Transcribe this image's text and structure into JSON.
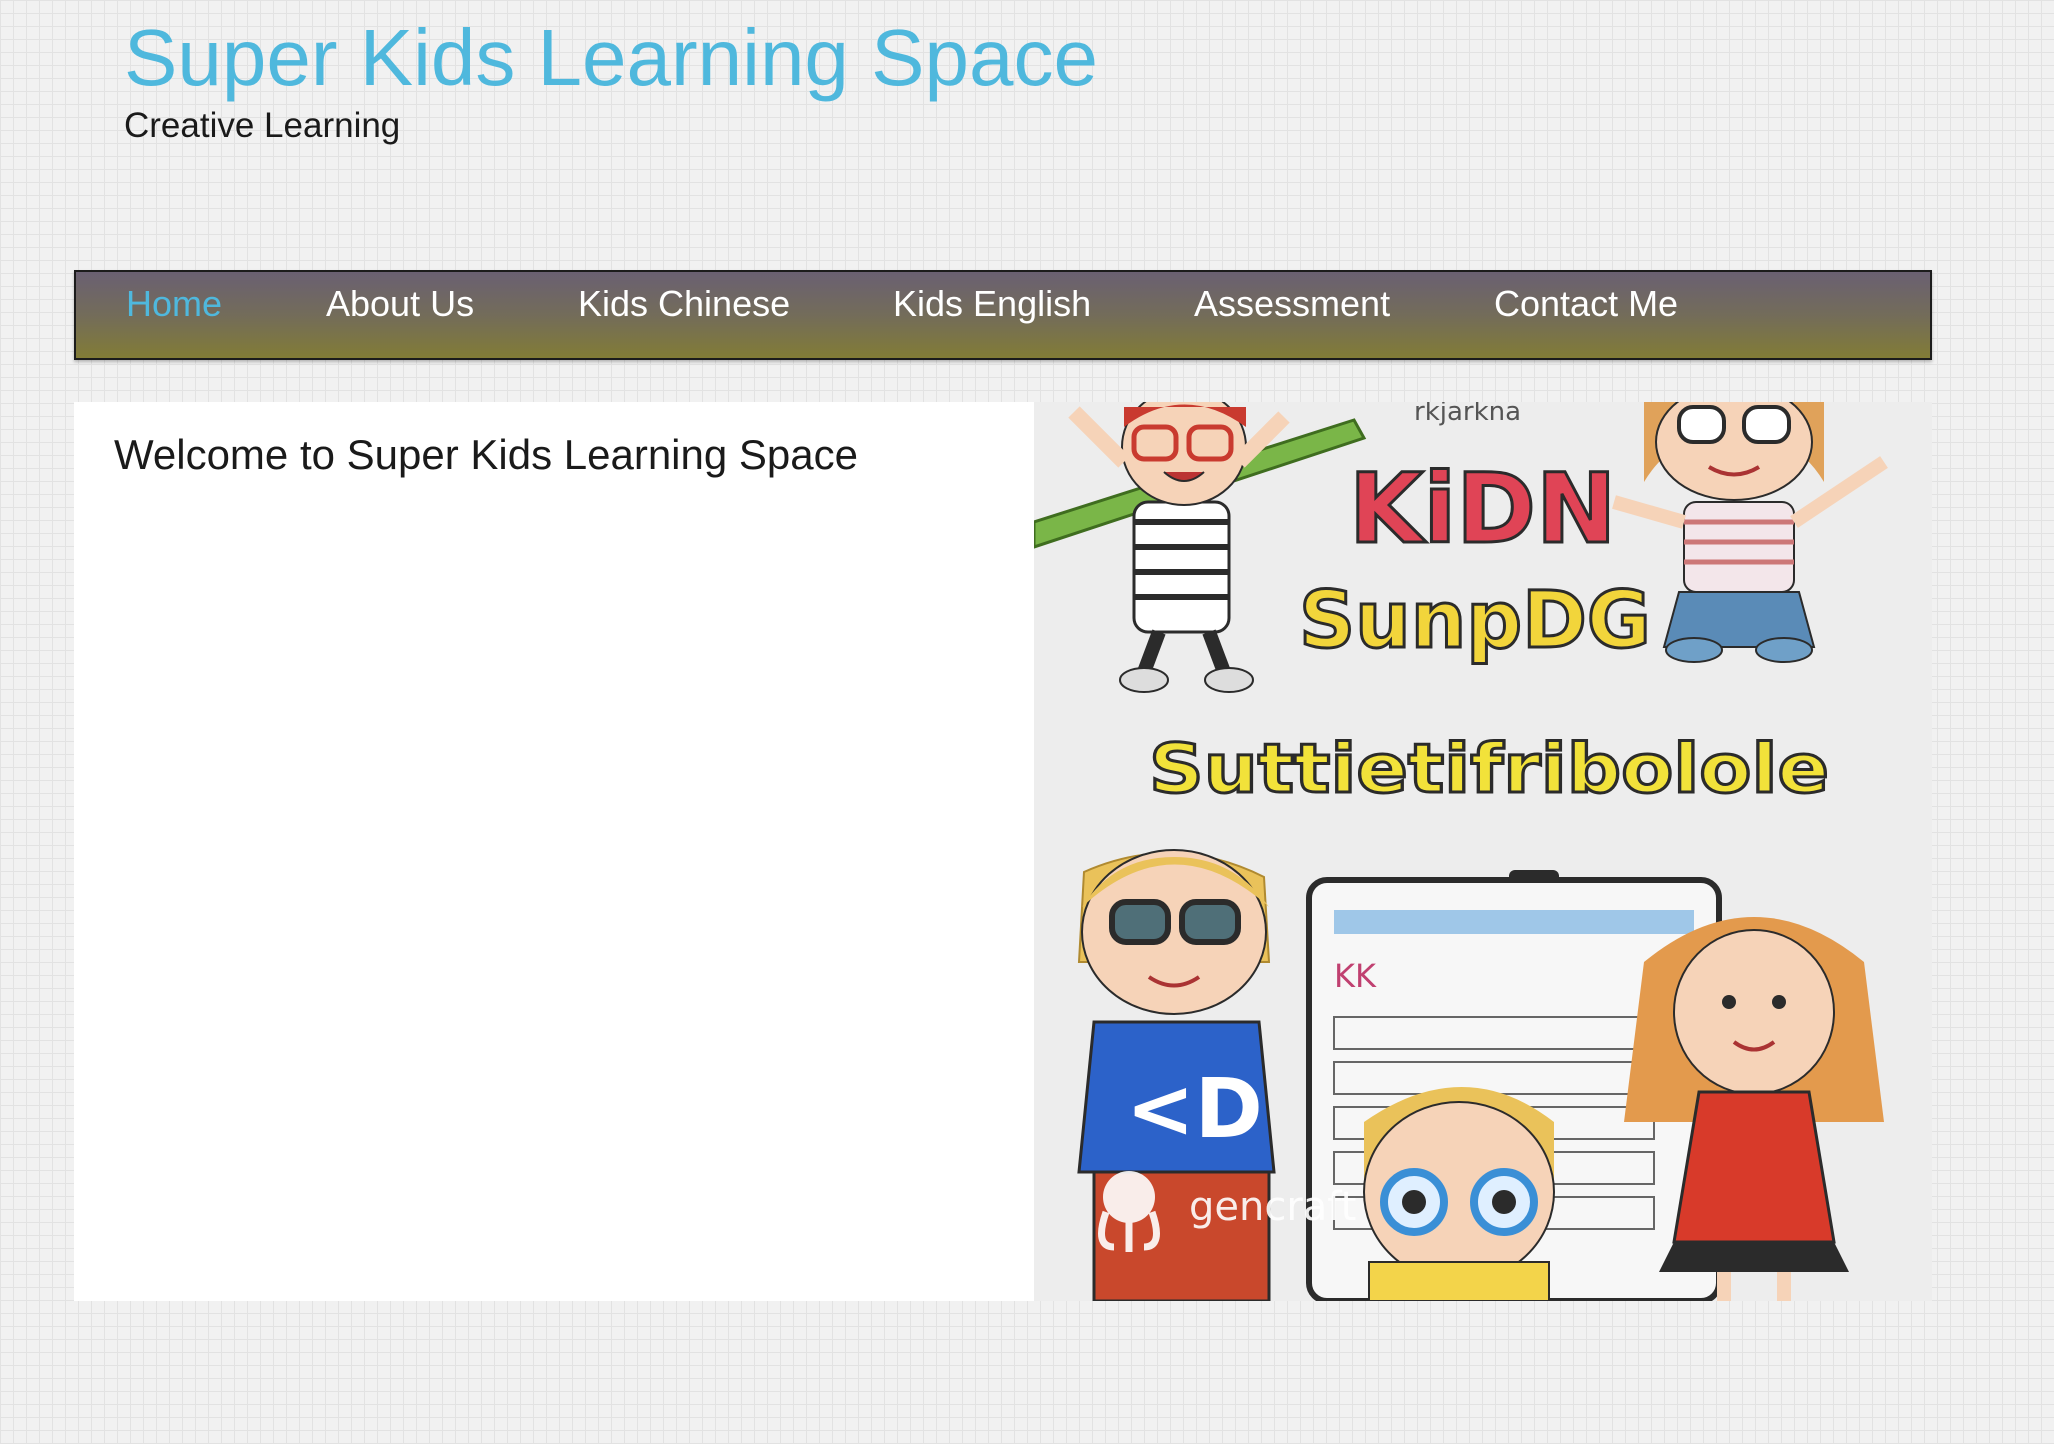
{
  "header": {
    "title": "Super Kids Learning Space",
    "tagline": "Creative Learning"
  },
  "nav": {
    "items": [
      {
        "label": "Home",
        "active": true
      },
      {
        "label": "About Us",
        "active": false
      },
      {
        "label": "Kids Chinese",
        "active": false
      },
      {
        "label": "Kids English",
        "active": false
      },
      {
        "label": "Assessment",
        "active": false
      },
      {
        "label": "Contact Me",
        "active": false
      }
    ]
  },
  "main": {
    "heading": "Welcome to Super Kids Learning Space",
    "hero_image": {
      "texts": {
        "top": "rkjarkna",
        "line1": "KiDN",
        "line2": "SunpDG",
        "line3": "Suttietifribolole",
        "badge": "<D",
        "tablet": "KK",
        "watermark": "gencraft"
      }
    }
  },
  "colors": {
    "accent": "#4fb8dd",
    "text": "#1a1a1a",
    "nav_top": "#6a6072",
    "nav_bottom": "#827c36",
    "page_bg": "#f1f1f1",
    "content_bg": "#ffffff"
  }
}
